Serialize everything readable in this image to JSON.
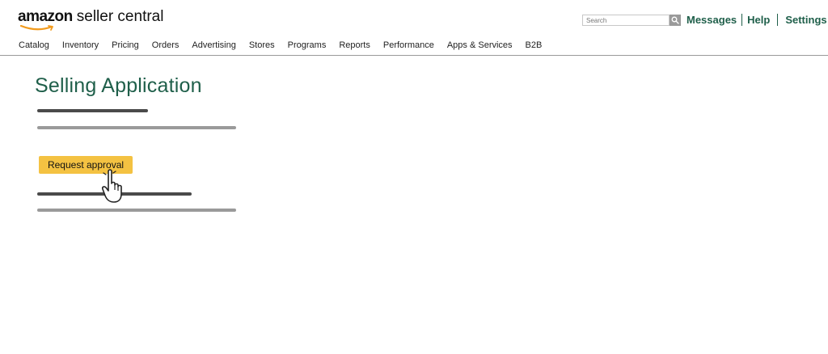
{
  "header": {
    "logo": {
      "amazon": "amazon",
      "rest": "seller central"
    },
    "search": {
      "placeholder": "Search",
      "button_icon": "search-icon"
    },
    "links": {
      "messages": "Messages",
      "help": "Help",
      "settings": "Settings"
    }
  },
  "nav": {
    "items": [
      "Catalog",
      "Inventory",
      "Pricing",
      "Orders",
      "Advertising",
      "Stores",
      "Programs",
      "Reports",
      "Performance",
      "Apps & Services",
      "B2B"
    ]
  },
  "main": {
    "title": "Selling Application",
    "request_button": "Request approval",
    "cursor_icon": "hand-pointer-icon"
  },
  "colors": {
    "brand_green": "#1f5f4a",
    "button_yellow": "#f4c242",
    "bar_dark": "#4a4a4a",
    "bar_light": "#9a9a9a",
    "smile_orange": "#f29b1d"
  }
}
